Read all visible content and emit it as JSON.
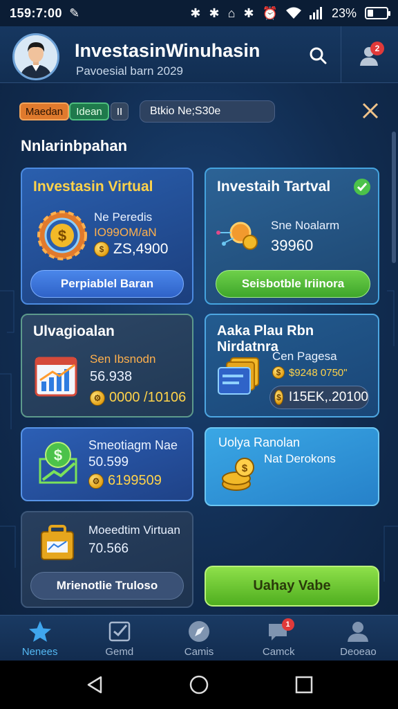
{
  "status_bar": {
    "time": "159:7:00",
    "battery": "23%",
    "battery_level": 0.23
  },
  "header": {
    "title": "InvestasinWinuhasin",
    "subtitle": "Pavoesial barn 2029",
    "notification_count": "2",
    "icons": [
      "search-icon",
      "user-icon"
    ]
  },
  "filters": {
    "chip1": "Maedan",
    "chip2": "Idean",
    "chip3": "II",
    "filter_text": "Btkio Ne;S30e"
  },
  "section": {
    "title": "Nnlarinbpahan"
  },
  "cards": {
    "c1": {
      "title": "Investasin Virtual",
      "line1": "Ne Peredis",
      "line2": "IO99OM/aN",
      "value": "ZS,4900",
      "button": "Perpiablel Baran"
    },
    "c2": {
      "title": "Investaih Tartval",
      "line1": "Sne Noalarm",
      "value": "39960",
      "button": "Seisbotble Iriinora"
    },
    "c3": {
      "title": "Ulvagioalan",
      "line1": "Sen Ibsnodn",
      "line2": "56.938",
      "value": "0000 /10106"
    },
    "c4": {
      "title": "Aaka Plau Rbn Nirdatnra",
      "line1": "Cen Pagesa",
      "line2": "$9248 0750\"",
      "value": "I15EK,.20100"
    },
    "c5": {
      "title": "Smeotiagm Nae",
      "line1": "50.599",
      "value": "6199509"
    },
    "c6": {
      "title": "Uolya Ranolan",
      "line1": "Nat Derokons"
    },
    "c7": {
      "title": "Moeedtim Virtuan",
      "line1": "70.566",
      "button": "Mrienotlie Truloso"
    },
    "cta": "Uahay Vabe"
  },
  "bottom_nav": [
    {
      "label": "Nenees",
      "icon": "star-icon",
      "active": true
    },
    {
      "label": "Gemd",
      "icon": "checklist-icon",
      "active": false
    },
    {
      "label": "Camis",
      "icon": "compass-icon",
      "active": false
    },
    {
      "label": "Camck",
      "icon": "chat-icon",
      "active": false,
      "badge": "1"
    },
    {
      "label": "Deoeao",
      "icon": "profile-icon",
      "active": false
    }
  ],
  "system_nav": [
    "back-icon",
    "home-icon",
    "recents-icon"
  ],
  "colors": {
    "accent_blue": "#54b8f2",
    "cta_green": "#6cc532",
    "badge_red": "#e03a3a",
    "coin_gold": "#e4a217"
  }
}
